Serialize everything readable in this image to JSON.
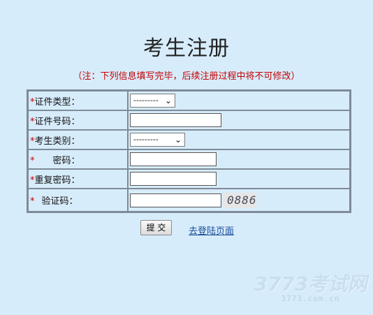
{
  "page": {
    "title": "考生注册",
    "note": "（注：下列信息填写完毕，后续注册过程中将不可修改）"
  },
  "form": {
    "required_mark": "*",
    "fields": [
      {
        "label": "证件类型：",
        "type": "select",
        "value": "---------"
      },
      {
        "label": "证件号码：",
        "type": "input",
        "value": ""
      },
      {
        "label": "考生类别：",
        "type": "select",
        "value": "---------"
      },
      {
        "label": "密码：",
        "type": "password",
        "value": ""
      },
      {
        "label": "重复密码：",
        "type": "password",
        "value": ""
      },
      {
        "label": "验证码：",
        "type": "input",
        "value": ""
      }
    ],
    "captcha_text": "0886"
  },
  "actions": {
    "submit_label": "提 交",
    "login_link": "去登陆页面"
  },
  "watermark": {
    "logo": "3773考试网",
    "url": "3773.com.cn"
  },
  "colors": {
    "background": "#d7ecfb",
    "required": "#c40000",
    "border": "#7e8b98",
    "link": "#1a4e9b"
  },
  "icons": {
    "select_arrow": "chevron-down-icon"
  }
}
